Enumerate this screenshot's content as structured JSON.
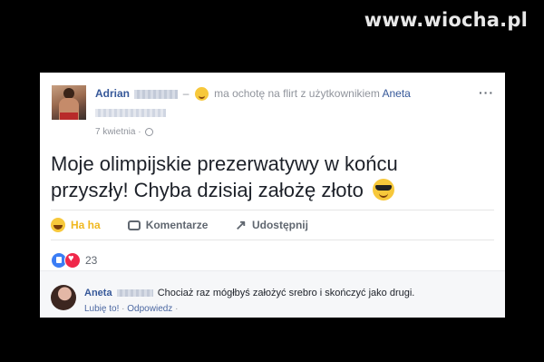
{
  "watermark": "www.wiocha.pl",
  "post": {
    "author": "Adrian",
    "feeling_text": "ma ochotę na flirt z użytkownikiem",
    "tagged_user": "Aneta",
    "date": "7 kwietnia",
    "separator": "·",
    "dash": "–",
    "menu": "···",
    "text_line1": "Moje olimpijskie prezerwatywy w końcu",
    "text_line2": "przyszły! Chyba dzisiaj założę złoto"
  },
  "actions": {
    "haha": "Ha ha",
    "comment": "Komentarze",
    "share": "Udostępnij"
  },
  "reactions": {
    "count": "23"
  },
  "comment": {
    "author": "Aneta",
    "text": "Chociaż raz mógłbyś założyć srebro i skończyć jako drugi.",
    "like": "Lubię to!",
    "dot": "·",
    "reply": "Odpowiedz"
  },
  "icon_share": "↗",
  "colors": {
    "link": "#365899",
    "haha": "#f0b81f",
    "like": "#3b7df5",
    "love": "#f0284a"
  }
}
